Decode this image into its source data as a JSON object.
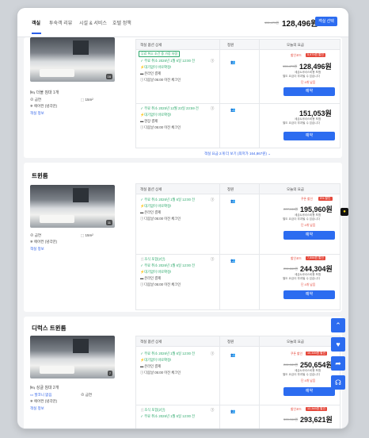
{
  "tabs": [
    {
      "label": "객실"
    },
    {
      "label": "투숙객 리뷰"
    },
    {
      "label": "시설 & 서비스"
    },
    {
      "label": "호텔 정책"
    }
  ],
  "header": {
    "old_price": "151,473원",
    "price": "128,496원",
    "select_label": "객실 선택"
  },
  "table_headers": {
    "option": "객실 옵션 상세",
    "capacity": "정원",
    "price": "오늘의 요금"
  },
  "rooms": [
    {
      "photo_count": "16",
      "bed": "더블 침대 1개",
      "amenities": [
        "금연",
        "15m²",
        "에어컨 (냉각만)"
      ],
      "info_link": "객실 정보",
      "rates": [
        {
          "chip": "무료 취소 조건 중 가장 저렴",
          "options": [
            {
              "text": "무료 취소 2026년 1월 6일 12:00 전",
              "style": "green"
            },
            {
              "text": "대기없이 바로확정!",
              "style": "green"
            },
            {
              "text": "온라인 결제",
              "style": "gray"
            },
            {
              "text": "다음날 05:00 이전 체크인",
              "style": "gray"
            }
          ],
          "discount": "5,979원 할인",
          "discount_label": "할인코드",
          "old": "151,473원",
          "price": "128,496원",
          "tax": "세금&서비스비용 포함",
          "tax2": "별도 요금이 부과될 수 있습니다",
          "remain": "단 4개 남음",
          "book": "예약"
        },
        {
          "options": [
            {
              "text": "무료 취소 2025년 12월 23일 23:59 전",
              "style": "green"
            },
            {
              "text": "대기없이 바로확정!",
              "style": "green"
            },
            {
              "text": "현장 결제",
              "style": "gray"
            },
            {
              "text": "다음날 05:00 이전 체크인",
              "style": "gray"
            }
          ],
          "price": "151,053원",
          "tax": "세금&서비스비용 포함",
          "tax2": "별도 요금이 부과될 수 있습니다",
          "book": "예약"
        }
      ],
      "more": "객실 요금 2개 더 보기 (최저가 164,867원)"
    }
  ],
  "twin": {
    "title": "트윈룸",
    "photo_count": "11",
    "amenities": [
      "금연",
      "15m²",
      "에어컨 (냉각만)"
    ],
    "info_link": "객실 정보",
    "rates": [
      {
        "options": [
          {
            "text": "무료 취소 2026년 1월 6일 12:00 전",
            "style": "green"
          },
          {
            "text": "대기없이 바로확정!",
            "style": "green"
          },
          {
            "text": "온라인 결제",
            "style": "gray"
          },
          {
            "text": "다음날 05:00 이전 체크인",
            "style": "gray"
          }
        ],
        "discount_label": "쿠폰 할인",
        "discount": "5% 할인",
        "old": "207,444원",
        "price": "195,960원",
        "tax": "세금&서비스비용 포함",
        "tax2": "별도 요금이 부과될 수 있습니다",
        "remain": "단 4개 남음",
        "book": "예약"
      },
      {
        "options": [
          {
            "text": "조식 포함(2인)",
            "style": "green"
          },
          {
            "text": "무료 취소 2026년 1월 6일 12:00 전",
            "style": "green"
          },
          {
            "text": "대기없이 바로확정!",
            "style": "green"
          },
          {
            "text": "온라인 결제",
            "style": "gray"
          },
          {
            "text": "다음날 05:00 이전 체크인",
            "style": "gray"
          }
        ],
        "discount_label": "할인코드",
        "discount": "7,556원 할인",
        "old": "251,860원",
        "price": "244,304원",
        "tax": "세금&서비스비용 포함",
        "tax2": "별도 요금이 부과될 수 있습니다",
        "remain": "단 4개 남음",
        "book": "예약"
      }
    ]
  },
  "deluxe": {
    "title": "디럭스 트윈룸",
    "photo_count": "7",
    "bed": "싱글 침대 2개",
    "amenities": [
      "발코니 없음",
      "금연",
      "에어컨 (냉각만)"
    ],
    "info_link": "객실 정보",
    "rates": [
      {
        "options": [
          {
            "text": "무료 취소 2026년 1월 6일 12:00 전",
            "style": "green"
          },
          {
            "text": "대기없이 바로확정!",
            "style": "green"
          },
          {
            "text": "온라인 결제",
            "style": "gray"
          },
          {
            "text": "다음날 05:00 이전 체크인",
            "style": "gray"
          }
        ],
        "discount_label": "쿠폰 할인",
        "discount": "10,339원 할인",
        "old": "261,089원",
        "price": "250,654원",
        "tax": "세금&서비스비용 포함",
        "tax2": "별도 요금이 부과될 수 있습니다",
        "remain": "단 4개 남음",
        "book": "예약"
      },
      {
        "options": [
          {
            "text": "조식 포함(2인)",
            "style": "green"
          },
          {
            "text": "무료 취소 2026년 1월 6일 12:00 전",
            "style": "green"
          }
        ],
        "discount_label": "할인코드",
        "discount": "12,345원 할인",
        "old": "305,966원",
        "price": "293,621원"
      }
    ]
  },
  "fabs": [
    {
      "icon": "up-icon"
    },
    {
      "icon": "heart-icon"
    },
    {
      "icon": "share-icon"
    },
    {
      "icon": "headset-icon"
    }
  ]
}
